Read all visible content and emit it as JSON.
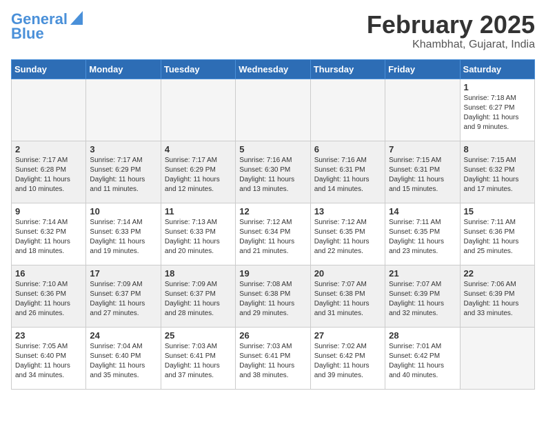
{
  "logo": {
    "line1": "General",
    "line2": "Blue"
  },
  "title": "February 2025",
  "subtitle": "Khambhat, Gujarat, India",
  "days_of_week": [
    "Sunday",
    "Monday",
    "Tuesday",
    "Wednesday",
    "Thursday",
    "Friday",
    "Saturday"
  ],
  "weeks": [
    [
      {
        "day": "",
        "info": ""
      },
      {
        "day": "",
        "info": ""
      },
      {
        "day": "",
        "info": ""
      },
      {
        "day": "",
        "info": ""
      },
      {
        "day": "",
        "info": ""
      },
      {
        "day": "",
        "info": ""
      },
      {
        "day": "1",
        "info": "Sunrise: 7:18 AM\nSunset: 6:27 PM\nDaylight: 11 hours\nand 9 minutes."
      }
    ],
    [
      {
        "day": "2",
        "info": "Sunrise: 7:17 AM\nSunset: 6:28 PM\nDaylight: 11 hours\nand 10 minutes."
      },
      {
        "day": "3",
        "info": "Sunrise: 7:17 AM\nSunset: 6:29 PM\nDaylight: 11 hours\nand 11 minutes."
      },
      {
        "day": "4",
        "info": "Sunrise: 7:17 AM\nSunset: 6:29 PM\nDaylight: 11 hours\nand 12 minutes."
      },
      {
        "day": "5",
        "info": "Sunrise: 7:16 AM\nSunset: 6:30 PM\nDaylight: 11 hours\nand 13 minutes."
      },
      {
        "day": "6",
        "info": "Sunrise: 7:16 AM\nSunset: 6:31 PM\nDaylight: 11 hours\nand 14 minutes."
      },
      {
        "day": "7",
        "info": "Sunrise: 7:15 AM\nSunset: 6:31 PM\nDaylight: 11 hours\nand 15 minutes."
      },
      {
        "day": "8",
        "info": "Sunrise: 7:15 AM\nSunset: 6:32 PM\nDaylight: 11 hours\nand 17 minutes."
      }
    ],
    [
      {
        "day": "9",
        "info": "Sunrise: 7:14 AM\nSunset: 6:32 PM\nDaylight: 11 hours\nand 18 minutes."
      },
      {
        "day": "10",
        "info": "Sunrise: 7:14 AM\nSunset: 6:33 PM\nDaylight: 11 hours\nand 19 minutes."
      },
      {
        "day": "11",
        "info": "Sunrise: 7:13 AM\nSunset: 6:33 PM\nDaylight: 11 hours\nand 20 minutes."
      },
      {
        "day": "12",
        "info": "Sunrise: 7:12 AM\nSunset: 6:34 PM\nDaylight: 11 hours\nand 21 minutes."
      },
      {
        "day": "13",
        "info": "Sunrise: 7:12 AM\nSunset: 6:35 PM\nDaylight: 11 hours\nand 22 minutes."
      },
      {
        "day": "14",
        "info": "Sunrise: 7:11 AM\nSunset: 6:35 PM\nDaylight: 11 hours\nand 23 minutes."
      },
      {
        "day": "15",
        "info": "Sunrise: 7:11 AM\nSunset: 6:36 PM\nDaylight: 11 hours\nand 25 minutes."
      }
    ],
    [
      {
        "day": "16",
        "info": "Sunrise: 7:10 AM\nSunset: 6:36 PM\nDaylight: 11 hours\nand 26 minutes."
      },
      {
        "day": "17",
        "info": "Sunrise: 7:09 AM\nSunset: 6:37 PM\nDaylight: 11 hours\nand 27 minutes."
      },
      {
        "day": "18",
        "info": "Sunrise: 7:09 AM\nSunset: 6:37 PM\nDaylight: 11 hours\nand 28 minutes."
      },
      {
        "day": "19",
        "info": "Sunrise: 7:08 AM\nSunset: 6:38 PM\nDaylight: 11 hours\nand 29 minutes."
      },
      {
        "day": "20",
        "info": "Sunrise: 7:07 AM\nSunset: 6:38 PM\nDaylight: 11 hours\nand 31 minutes."
      },
      {
        "day": "21",
        "info": "Sunrise: 7:07 AM\nSunset: 6:39 PM\nDaylight: 11 hours\nand 32 minutes."
      },
      {
        "day": "22",
        "info": "Sunrise: 7:06 AM\nSunset: 6:39 PM\nDaylight: 11 hours\nand 33 minutes."
      }
    ],
    [
      {
        "day": "23",
        "info": "Sunrise: 7:05 AM\nSunset: 6:40 PM\nDaylight: 11 hours\nand 34 minutes."
      },
      {
        "day": "24",
        "info": "Sunrise: 7:04 AM\nSunset: 6:40 PM\nDaylight: 11 hours\nand 35 minutes."
      },
      {
        "day": "25",
        "info": "Sunrise: 7:03 AM\nSunset: 6:41 PM\nDaylight: 11 hours\nand 37 minutes."
      },
      {
        "day": "26",
        "info": "Sunrise: 7:03 AM\nSunset: 6:41 PM\nDaylight: 11 hours\nand 38 minutes."
      },
      {
        "day": "27",
        "info": "Sunrise: 7:02 AM\nSunset: 6:42 PM\nDaylight: 11 hours\nand 39 minutes."
      },
      {
        "day": "28",
        "info": "Sunrise: 7:01 AM\nSunset: 6:42 PM\nDaylight: 11 hours\nand 40 minutes."
      },
      {
        "day": "",
        "info": ""
      }
    ]
  ]
}
